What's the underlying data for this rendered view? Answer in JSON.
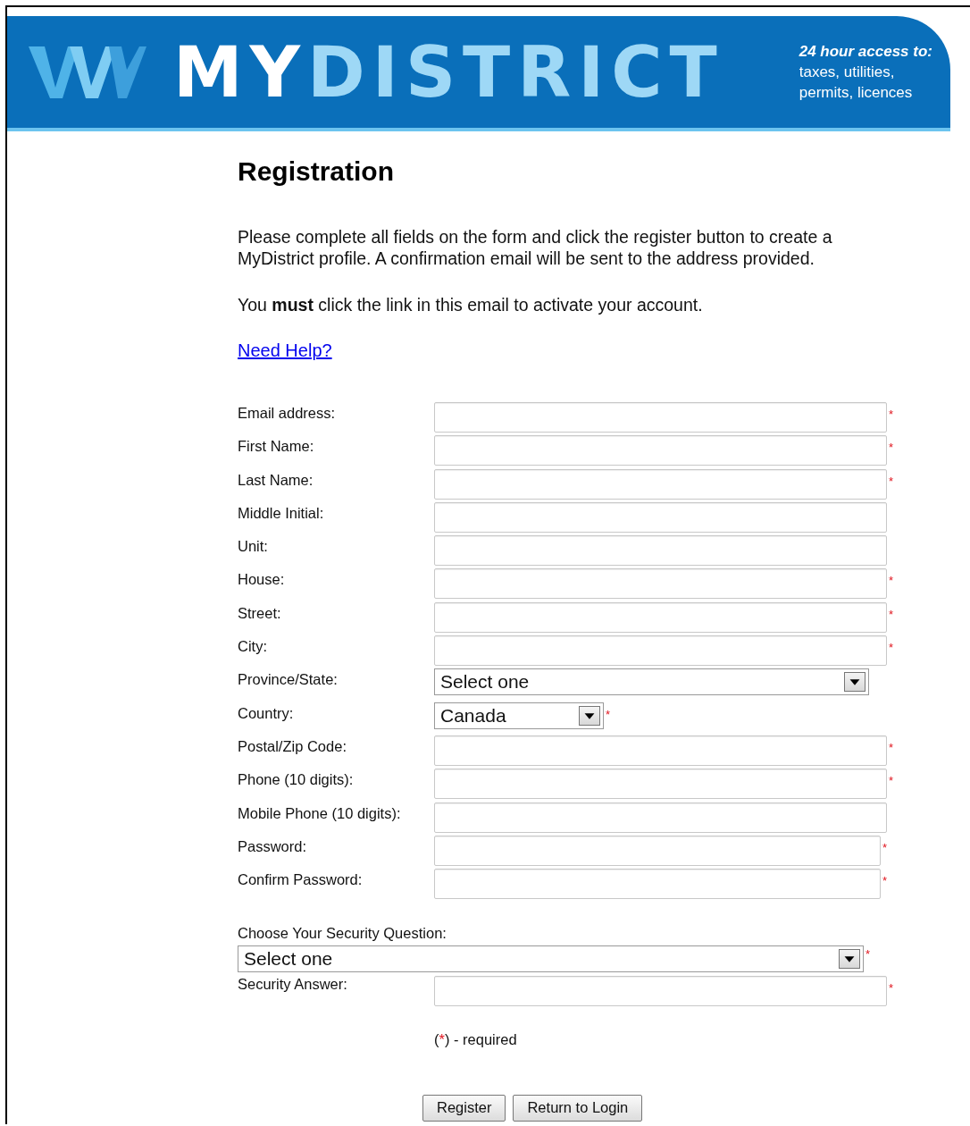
{
  "header": {
    "logo_plain": "MY",
    "logo_accent": "DISTRICT",
    "tagline_lead": "24 hour access to:",
    "tagline_lines": [
      "taxes, utilities,",
      "permits, licences"
    ]
  },
  "title": "Registration",
  "intro": [
    "Please complete all fields on the form and click the register button to create a MyDistrict profile. A confirmation email will be sent to the address provided.",
    "You **must** click the link in this email to activate your account."
  ],
  "help_link": "Need Help?",
  "fields": [
    {
      "label": "Email address:",
      "kind": "text",
      "mark": "*"
    },
    {
      "label": "First Name:",
      "kind": "text",
      "mark": "*"
    },
    {
      "label": "Last Name:",
      "kind": "text",
      "mark": "*"
    },
    {
      "label": "Middle Initial:",
      "kind": "text"
    },
    {
      "label": "Unit:",
      "kind": "text"
    },
    {
      "label": "House:",
      "kind": "text",
      "mark": "*"
    },
    {
      "label": "Street:",
      "kind": "text",
      "mark": "*"
    },
    {
      "label": "City:",
      "kind": "text",
      "mark": "*"
    },
    {
      "label": "Province/State:",
      "kind": "select",
      "value": "Select one"
    },
    {
      "label": "Country:",
      "kind": "select-short",
      "value": "Canada",
      "mark": "*"
    },
    {
      "label": "Postal/Zip Code:",
      "kind": "text",
      "mark": "*"
    },
    {
      "label": "Phone (10 digits):",
      "kind": "text",
      "mark": "*"
    },
    {
      "label": "Mobile Phone (10 digits):",
      "kind": "text"
    },
    {
      "label": "Password:",
      "kind": "password",
      "mark": "*"
    },
    {
      "label": "Confirm Password:",
      "kind": "password",
      "mark": "*"
    }
  ],
  "security": {
    "question_label": "Choose Your Security Question:",
    "question_value": "Select one",
    "question_mark": "*",
    "answer_label": "Security Answer:",
    "answer_mark": "*"
  },
  "legend": {
    "open": "(",
    "mark": "*",
    "rest": ") - required"
  },
  "buttons": [
    "Register",
    "Return to Login"
  ]
}
